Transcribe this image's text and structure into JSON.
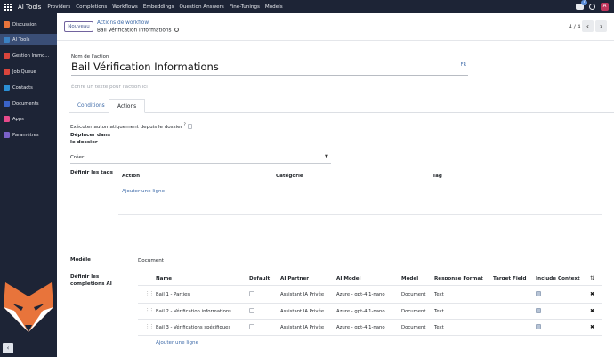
{
  "topbar": {
    "brand": "AI Tools",
    "menu": [
      "Providers",
      "Completions",
      "Workflows",
      "Embeddings",
      "Question Answers",
      "Fine-Tunings",
      "Models"
    ],
    "chat_badge": "7",
    "avatar_letter": "A"
  },
  "sidebar": {
    "items": [
      {
        "label": "Discussion",
        "icon": "discussion-icon",
        "color": "#e8743b"
      },
      {
        "label": "AI Tools",
        "icon": "ai-tools-icon",
        "color": "#3b82c4",
        "active": true
      },
      {
        "label": "Gestion Immo...",
        "icon": "building-icon",
        "color": "#d9453c"
      },
      {
        "label": "Job Queue",
        "icon": "queue-icon",
        "color": "#d9453c"
      },
      {
        "label": "Contacts",
        "icon": "contacts-icon",
        "color": "#2b8fd6"
      },
      {
        "label": "Documents",
        "icon": "documents-icon",
        "color": "#3a63c9"
      },
      {
        "label": "Apps",
        "icon": "apps-icon",
        "color": "#e64a8b"
      },
      {
        "label": "Paramètres",
        "icon": "settings-icon",
        "color": "#7b61c9"
      }
    ]
  },
  "breadcrumb": {
    "new_button": "Nouveau",
    "parent": "Actions de workflow",
    "current": "Bail Vérification Informations",
    "pager": "4 / 4"
  },
  "form": {
    "name_label": "Nom de l'action",
    "title": "Bail Vérification Informations",
    "lang": "FR",
    "tooltip_placeholder": "Écrire un texte pour l'action ici",
    "tabs": [
      "Conditions",
      "Actions"
    ],
    "active_tab": "Actions",
    "auto_exec_label": "Exécuter automatiquement depuis le dossier",
    "auto_exec_mark": "?",
    "move_label": "Déplacer dans le dossier",
    "move_value": "Créer",
    "tags_label": "Définir les tags",
    "tags_columns": [
      "Action",
      "Catégorie",
      "Tag"
    ],
    "add_line": "Ajouter une ligne",
    "model_label": "Modèle",
    "model_value": "Document",
    "completions_label": "Définir les completions AI",
    "completion_columns": [
      "Name",
      "Default",
      "AI Partner",
      "AI Model",
      "Model",
      "Response Format",
      "Target Field",
      "Include Context"
    ],
    "completions": [
      {
        "name": "Bail 1 - Parties",
        "default": false,
        "partner": "Assistant IA Privée",
        "ai_model": "Azure - gpt-4.1-nano",
        "model": "Document",
        "format": "Text",
        "target": "",
        "context": true
      },
      {
        "name": "Bail 2 - Vérification informations",
        "default": false,
        "partner": "Assistant IA Privée",
        "ai_model": "Azure - gpt-4.1-nano",
        "model": "Document",
        "format": "Text",
        "target": "",
        "context": true
      },
      {
        "name": "Bail 3 - Vérifications spécifiques",
        "default": false,
        "partner": "Assistant IA Privée",
        "ai_model": "Azure - gpt-4.1-nano",
        "model": "Document",
        "format": "Text",
        "target": "",
        "context": true
      }
    ],
    "add_completion": "Ajouter une ligne"
  }
}
